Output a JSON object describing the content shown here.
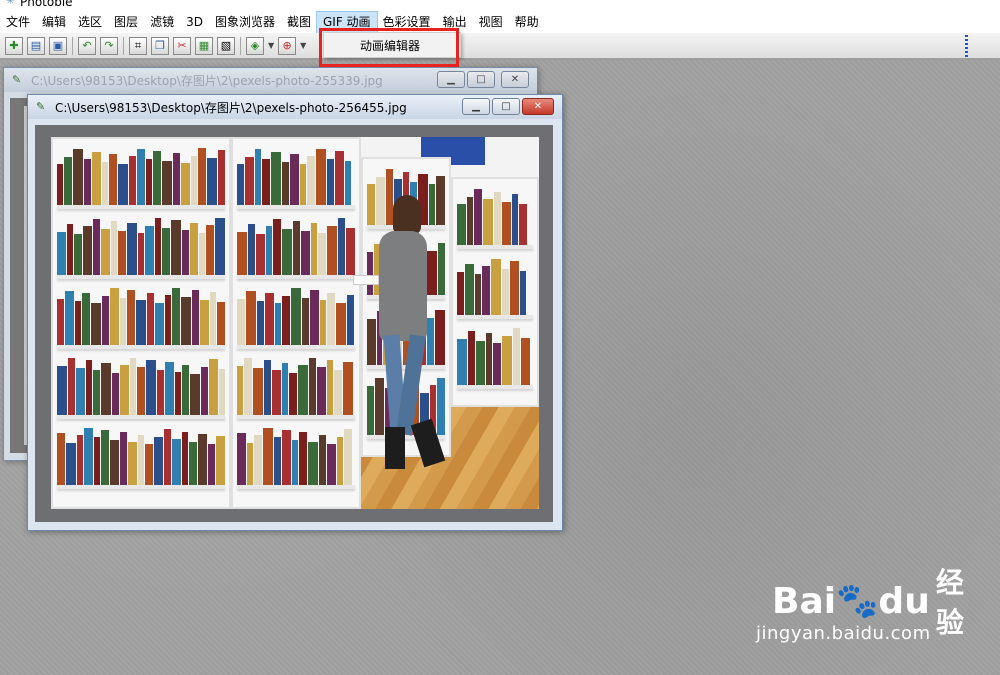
{
  "app": {
    "title": "Photoble"
  },
  "menubar": {
    "items": [
      {
        "label": "文件"
      },
      {
        "label": "编辑"
      },
      {
        "label": "选区"
      },
      {
        "label": "图层"
      },
      {
        "label": "滤镜"
      },
      {
        "label": "3D"
      },
      {
        "label": "图象浏览器"
      },
      {
        "label": "截图"
      },
      {
        "label": "GIF 动画",
        "active": true
      },
      {
        "label": "色彩设置"
      },
      {
        "label": "输出"
      },
      {
        "label": "视图"
      },
      {
        "label": "帮助"
      }
    ]
  },
  "dropdown": {
    "items": [
      {
        "label": "动画编辑器"
      }
    ]
  },
  "toolbar": {
    "icons": [
      "new-icon",
      "open-icon",
      "save-icon",
      "undo-icon",
      "redo-icon",
      "crop-icon",
      "copy-icon",
      "cut-icon",
      "paste-icon",
      "clipboard-icon",
      "effect-icon",
      "zoom-icon"
    ]
  },
  "windows": {
    "back": {
      "title": "C:\\Users\\98153\\Desktop\\存图片\\2\\pexels-photo-255339.jpg"
    },
    "front": {
      "title": "C:\\Users\\98153\\Desktop\\存图片\\2\\pexels-photo-256455.jpg"
    }
  },
  "watermark": {
    "brand": "Bai",
    "brand2": "du",
    "cn": "经验",
    "url": "jingyan.baidu.com"
  },
  "colors": {
    "highlight": "#e8221f",
    "workspace": "#a0a0a0"
  }
}
